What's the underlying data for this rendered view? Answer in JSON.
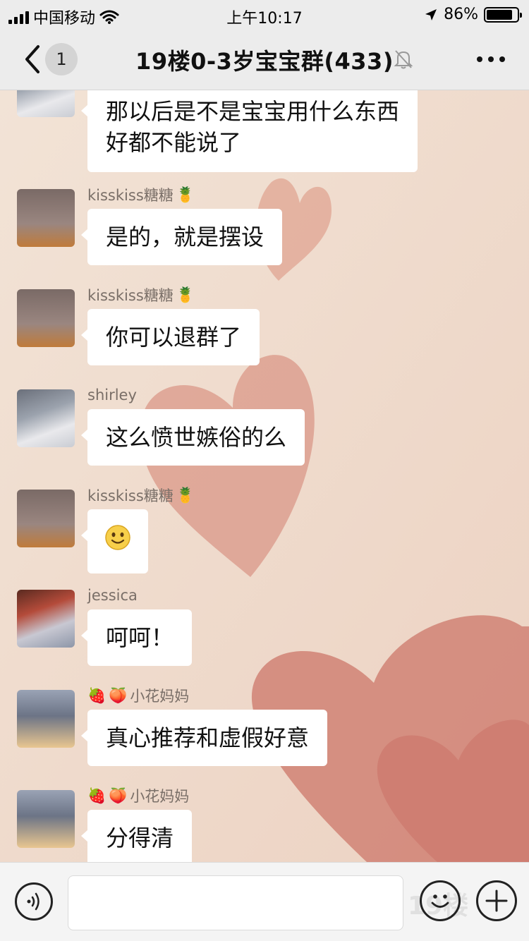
{
  "status_bar": {
    "carrier": "中国移动",
    "time": "上午10:17",
    "battery_percent": "86%",
    "battery_level": 0.86
  },
  "nav": {
    "back_icon": "chevron-left-icon",
    "unread_count": "1",
    "title": "19楼0-3岁宝宝群(433)",
    "mute_icon": "bell-off-icon",
    "more_icon": "more-dots-icon"
  },
  "messages": [
    {
      "sender": "",
      "text_lines": [
        "那以后是不是宝宝用什么东西",
        "好都不能说了"
      ],
      "avatar": "baby-avatar"
    },
    {
      "sender": "kisskiss糖糖",
      "badge": "pineapple-emoji",
      "text": "是的，就是摆设",
      "avatar": "girl-avatar"
    },
    {
      "sender": "kisskiss糖糖",
      "badge": "pineapple-emoji",
      "text": "你可以退群了",
      "avatar": "girl-avatar"
    },
    {
      "sender": "shirley",
      "text": "这么愤世嫉俗的么",
      "avatar": "baby-avatar"
    },
    {
      "sender": "kisskiss糖糖",
      "badge": "pineapple-emoji",
      "text": "",
      "emoji": "smile-emoji",
      "avatar": "girl-avatar"
    },
    {
      "sender": "jessica",
      "text": "呵呵！",
      "avatar": "kids-avatar"
    },
    {
      "sender": "小花妈妈",
      "prefix_badges": [
        "strawberry-emoji",
        "peach-emoji"
      ],
      "text": "真心推荐和虚假好意",
      "avatar": "cartoon-avatar"
    },
    {
      "sender": "小花妈妈",
      "prefix_badges": [
        "strawberry-emoji",
        "peach-emoji"
      ],
      "text": "分得清",
      "avatar": "cartoon-avatar"
    }
  ],
  "input_bar": {
    "voice_icon": "voice-icon",
    "emoji_icon": "emoji-icon",
    "plus_icon": "plus-icon",
    "watermark": "19楼"
  },
  "colors": {
    "background": "#f0dccd",
    "heart": "#d98f7f",
    "bar": "#ececec"
  }
}
